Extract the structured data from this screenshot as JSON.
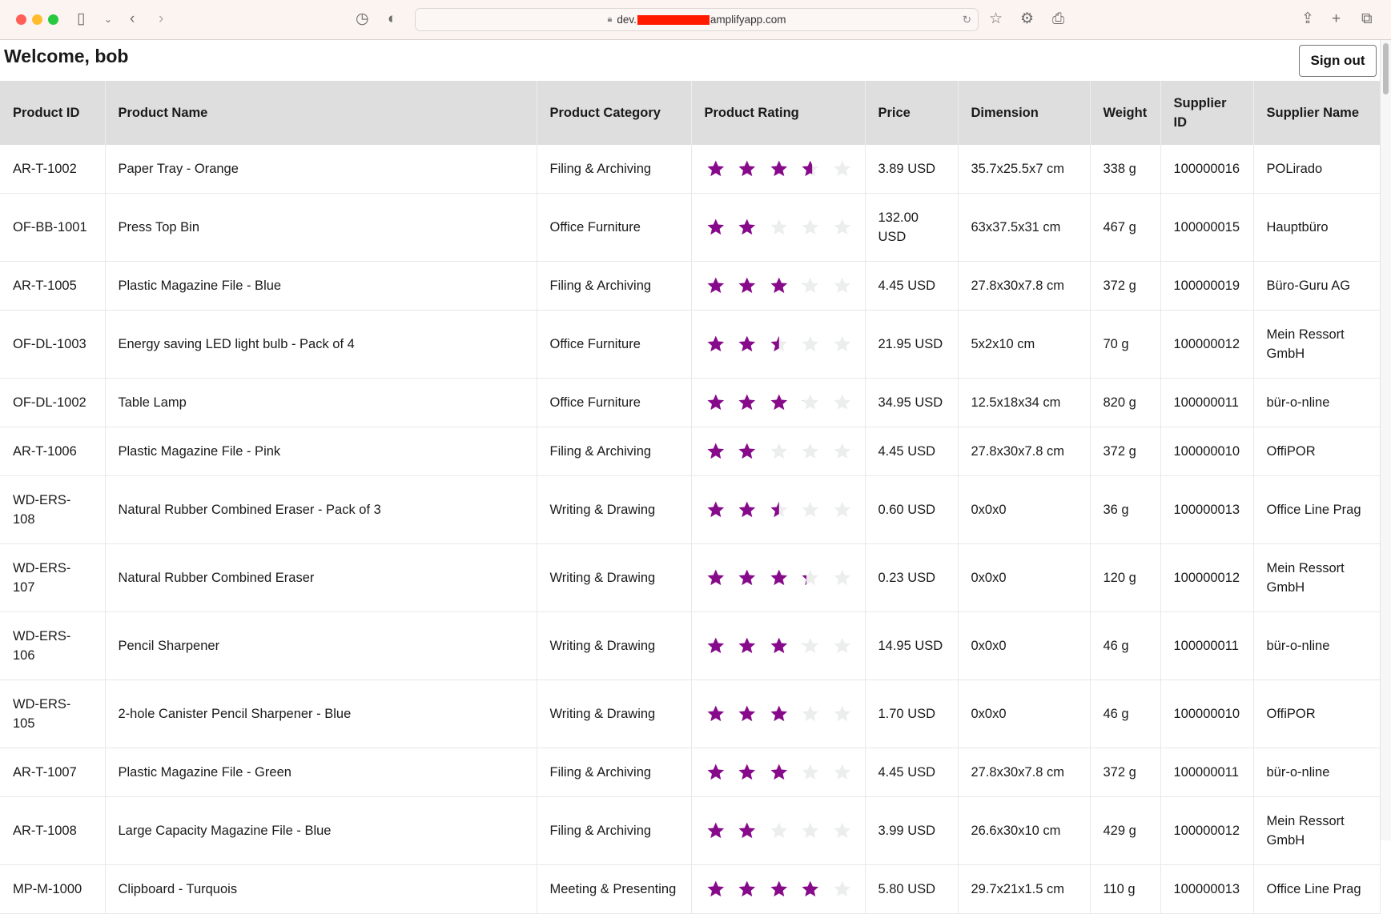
{
  "browser": {
    "url": "dev.",
    "url_suffix": "amplifyapp.com"
  },
  "header": {
    "welcome": "Welcome, bob",
    "sign_out": "Sign out"
  },
  "colors": {
    "star_filled": "#870a8a",
    "star_empty": "#eceeee"
  },
  "table": {
    "columns": [
      "Product ID",
      "Product Name",
      "Product Category",
      "Product Rating",
      "Price",
      "Dimension",
      "Weight",
      "Supplier ID",
      "Supplier Name"
    ],
    "rows": [
      {
        "id": "AR-T-1002",
        "name": "Paper Tray - Orange",
        "category": "Filing & Archiving",
        "rating": 3.6,
        "price": "3.89 USD",
        "dimension": "35.7x25.5x7 cm",
        "weight": "338 g",
        "supplier_id": "100000016",
        "supplier": "POLirado"
      },
      {
        "id": "OF-BB-1001",
        "name": "Press Top Bin",
        "category": "Office Furniture",
        "rating": 2,
        "price": "132.00 USD",
        "dimension": "63x37.5x31 cm",
        "weight": "467 g",
        "supplier_id": "100000015",
        "supplier": "Hauptbüro"
      },
      {
        "id": "AR-T-1005",
        "name": "Plastic Magazine File - Blue",
        "category": "Filing & Archiving",
        "rating": 3.1,
        "price": "4.45 USD",
        "dimension": "27.8x30x7.8 cm",
        "weight": "372 g",
        "supplier_id": "100000019",
        "supplier": "Büro-Guru AG"
      },
      {
        "id": "OF-DL-1003",
        "name": "Energy saving LED light bulb - Pack of 4",
        "category": "Office Furniture",
        "rating": 2.5,
        "price": "21.95 USD",
        "dimension": "5x2x10 cm",
        "weight": "70 g",
        "supplier_id": "100000012",
        "supplier": "Mein Ressort GmbH"
      },
      {
        "id": "OF-DL-1002",
        "name": "Table Lamp",
        "category": "Office Furniture",
        "rating": 3.1,
        "price": "34.95 USD",
        "dimension": "12.5x18x34 cm",
        "weight": "820 g",
        "supplier_id": "100000011",
        "supplier": "bür-o-nline"
      },
      {
        "id": "AR-T-1006",
        "name": "Plastic Magazine File - Pink",
        "category": "Filing & Archiving",
        "rating": 2,
        "price": "4.45 USD",
        "dimension": "27.8x30x7.8 cm",
        "weight": "372 g",
        "supplier_id": "100000010",
        "supplier": "OffiPOR"
      },
      {
        "id": "WD-ERS-108",
        "name": "Natural Rubber Combined Eraser - Pack of 3",
        "category": "Writing & Drawing",
        "rating": 2.5,
        "price": "0.60 USD",
        "dimension": "0x0x0",
        "weight": "36 g",
        "supplier_id": "100000013",
        "supplier": "Office Line Prag"
      },
      {
        "id": "WD-ERS-107",
        "name": "Natural Rubber Combined Eraser",
        "category": "Writing & Drawing",
        "rating": 3.3,
        "price": "0.23 USD",
        "dimension": "0x0x0",
        "weight": "120 g",
        "supplier_id": "100000012",
        "supplier": "Mein Ressort GmbH"
      },
      {
        "id": "WD-ERS-106",
        "name": "Pencil Sharpener",
        "category": "Writing & Drawing",
        "rating": 3.1,
        "price": "14.95 USD",
        "dimension": "0x0x0",
        "weight": "46 g",
        "supplier_id": "100000011",
        "supplier": "bür-o-nline"
      },
      {
        "id": "WD-ERS-105",
        "name": "2-hole Canister Pencil Sharpener - Blue",
        "category": "Writing & Drawing",
        "rating": 3,
        "price": "1.70 USD",
        "dimension": "0x0x0",
        "weight": "46 g",
        "supplier_id": "100000010",
        "supplier": "OffiPOR"
      },
      {
        "id": "AR-T-1007",
        "name": "Plastic Magazine File - Green",
        "category": "Filing & Archiving",
        "rating": 3,
        "price": "4.45 USD",
        "dimension": "27.8x30x7.8 cm",
        "weight": "372 g",
        "supplier_id": "100000011",
        "supplier": "bür-o-nline"
      },
      {
        "id": "AR-T-1008",
        "name": "Large Capacity Magazine File - Blue",
        "category": "Filing & Archiving",
        "rating": 2,
        "price": "3.99 USD",
        "dimension": "26.6x30x10 cm",
        "weight": "429 g",
        "supplier_id": "100000012",
        "supplier": "Mein Ressort GmbH"
      },
      {
        "id": "MP-M-1000",
        "name": "Clipboard - Turquois",
        "category": "Meeting & Presenting",
        "rating": 4,
        "price": "5.80 USD",
        "dimension": "29.7x21x1.5 cm",
        "weight": "110 g",
        "supplier_id": "100000013",
        "supplier": "Office Line Prag"
      }
    ]
  }
}
